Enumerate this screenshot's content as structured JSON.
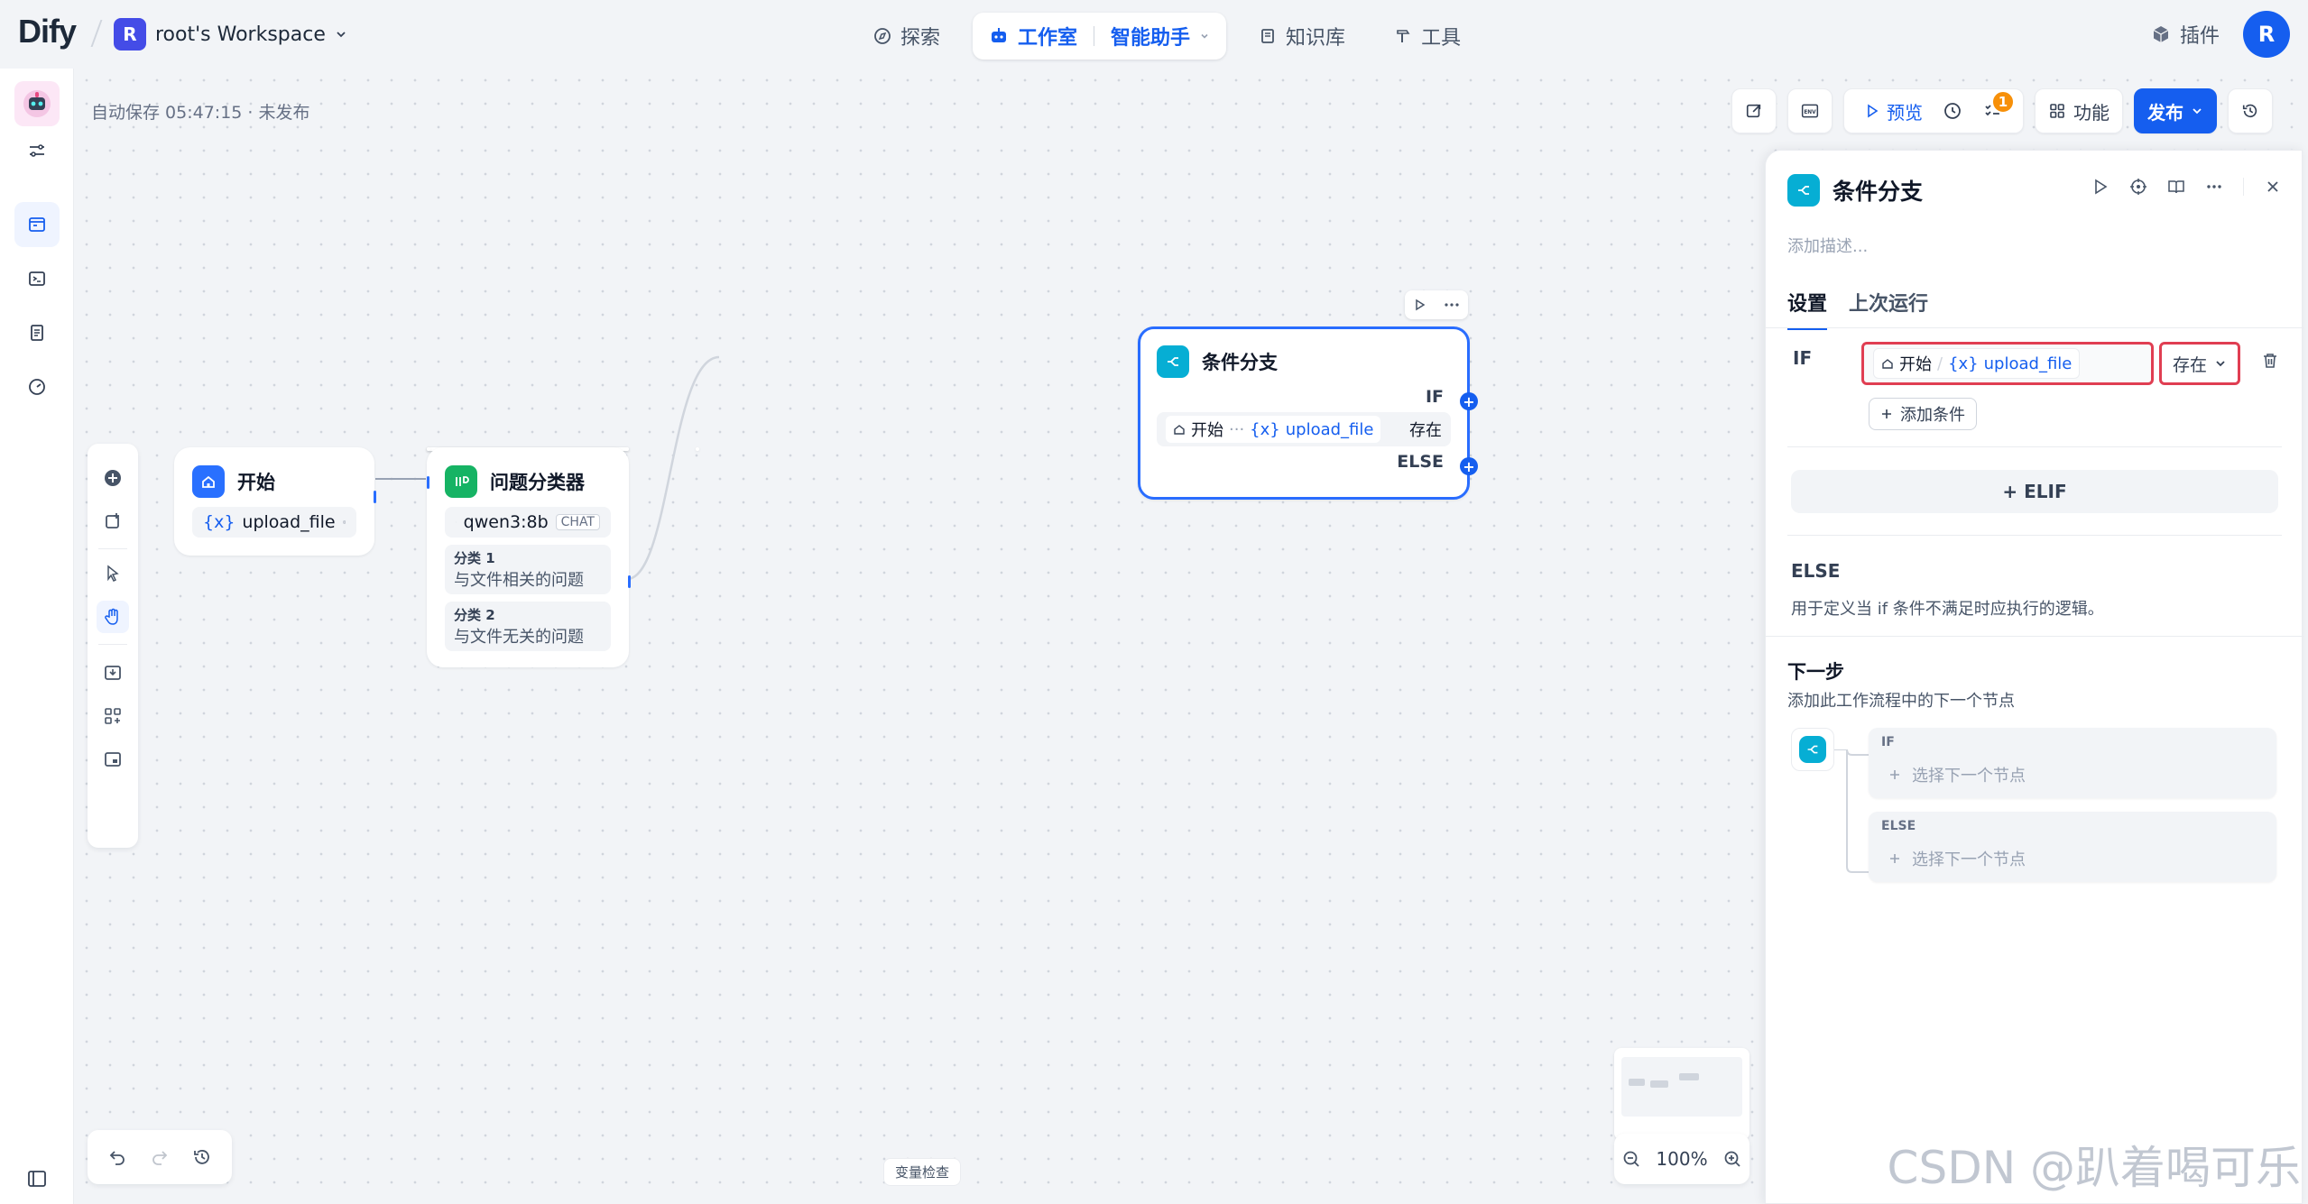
{
  "app": {
    "logo_text": "Dify",
    "workspace_initial": "R",
    "workspace_name": "root's Workspace",
    "user_initial": "R"
  },
  "nav": {
    "explore": "探索",
    "studio": "工作室",
    "assistant": "智能助手",
    "knowledge": "知识库",
    "tools": "工具",
    "plugins": "插件"
  },
  "canvas": {
    "autosave": "自动保存 05:47:15 · 未发布",
    "var_check": "变量检查",
    "zoom": "100%"
  },
  "toolbar": {
    "preview": "预览",
    "features": "功能",
    "publish": "发布",
    "badge_count": "1"
  },
  "nodes": {
    "start": {
      "title": "开始",
      "var": "upload_file"
    },
    "classifier": {
      "title": "问题分类器",
      "model": "qwen3:8b",
      "model_tag": "CHAT",
      "classes": [
        {
          "label": "分类 1",
          "text": "与文件相关的问题"
        },
        {
          "label": "分类 2",
          "text": "与文件无关的问题"
        }
      ]
    },
    "ifelse": {
      "title": "条件分支",
      "if_label": "IF",
      "else_label": "ELSE",
      "cond_source": "开始",
      "cond_dots": "···",
      "cond_var": "upload_file",
      "cond_op": "存在"
    }
  },
  "panel": {
    "title": "条件分支",
    "desc_placeholder": "添加描述...",
    "tabs": [
      "设置",
      "上次运行"
    ],
    "if_label": "IF",
    "cond_source": "开始",
    "cond_var": "upload_file",
    "cond_op": "存在",
    "add_condition": "添加条件",
    "elif": "+ ELIF",
    "else_label": "ELSE",
    "else_desc": "用于定义当 if 条件不满足时应执行的逻辑。",
    "next_title": "下一步",
    "next_desc": "添加此工作流程中的下一个节点",
    "branch_if": "IF",
    "branch_else": "ELSE",
    "select_next": "选择下一个节点"
  },
  "watermark": "CSDN @趴着喝可乐",
  "colors": {
    "primary": "#155eef",
    "start_icon": "#2970ff",
    "classifier_icon": "#16b364",
    "ifelse_icon": "#06aed4",
    "highlight_border": "#e03e52"
  }
}
